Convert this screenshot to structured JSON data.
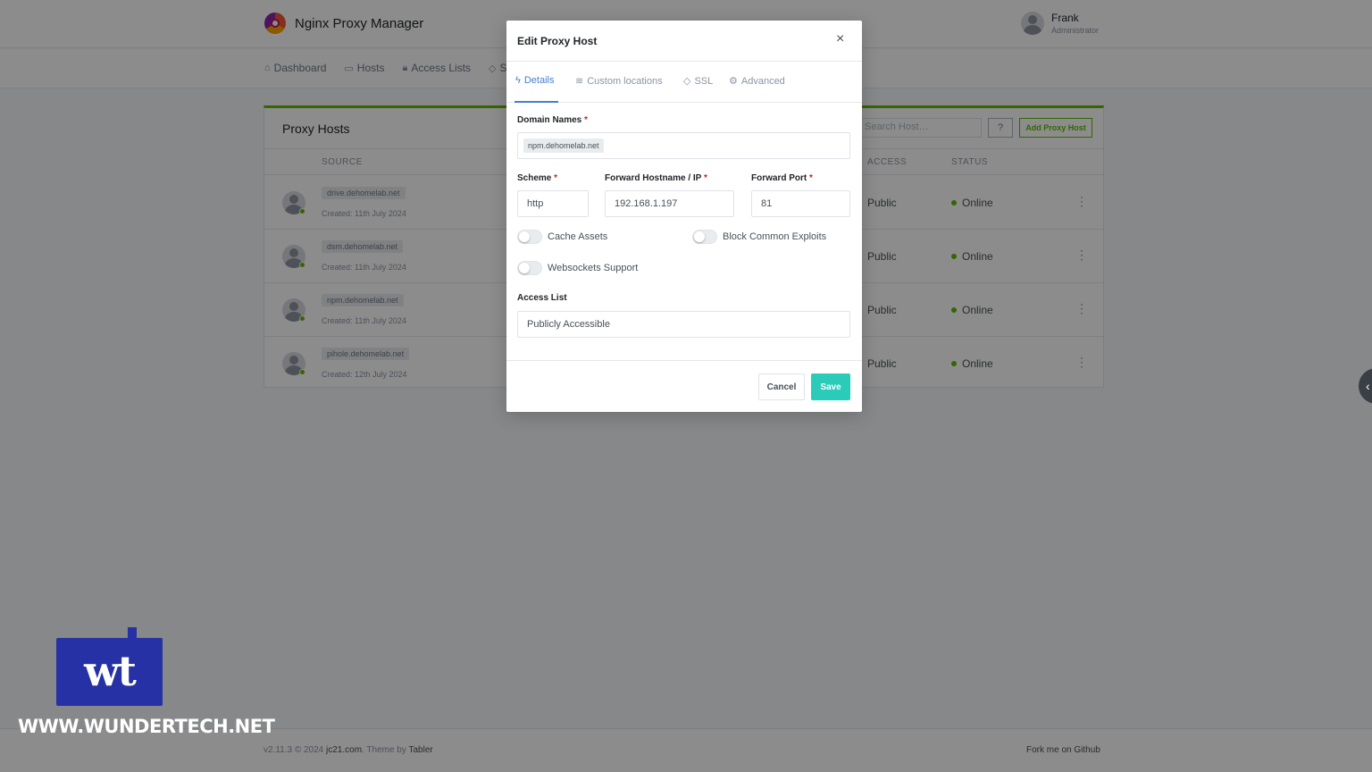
{
  "app": {
    "title": "Nginx Proxy Manager"
  },
  "user": {
    "name": "Frank",
    "role": "Administrator"
  },
  "nav": {
    "items": [
      {
        "label": "Dashboard",
        "icon": "home-icon"
      },
      {
        "label": "Hosts",
        "icon": "monitor-icon"
      },
      {
        "label": "Access Lists",
        "icon": "lock-icon"
      },
      {
        "label": "SSL",
        "icon": "shield-icon"
      }
    ]
  },
  "card": {
    "title": "Proxy Hosts",
    "search_placeholder": "Search Host…",
    "add_label": "Add Proxy Host",
    "columns": {
      "source": "SOURCE",
      "access": "ACCESS",
      "status": "STATUS"
    },
    "rows": [
      {
        "domain": "drive.dehomelab.net",
        "created": "Created: 11th July 2024",
        "access": "Public",
        "status": "Online"
      },
      {
        "domain": "dsm.dehomelab.net",
        "created": "Created: 11th July 2024",
        "access": "Public",
        "status": "Online"
      },
      {
        "domain": "npm.dehomelab.net",
        "created": "Created: 11th July 2024",
        "access": "Public",
        "status": "Online"
      },
      {
        "domain": "pihole.dehomelab.net",
        "created": "Created: 12th July 2024",
        "access": "Public",
        "status": "Online"
      }
    ]
  },
  "modal": {
    "title": "Edit Proxy Host",
    "tabs": [
      {
        "label": "Details",
        "icon": "bolt-icon",
        "active": true
      },
      {
        "label": "Custom locations",
        "icon": "layers-icon"
      },
      {
        "label": "SSL",
        "icon": "shield-icon"
      },
      {
        "label": "Advanced",
        "icon": "gear-icon"
      }
    ],
    "domain_names": {
      "label": "Domain Names",
      "required": "*",
      "value": "npm.dehomelab.net"
    },
    "scheme": {
      "label": "Scheme",
      "required": "*",
      "value": "http"
    },
    "forward_host": {
      "label": "Forward Hostname / IP",
      "required": "*",
      "value": "192.168.1.197"
    },
    "forward_port": {
      "label": "Forward Port",
      "required": "*",
      "value": "81"
    },
    "toggles": {
      "cache_assets": {
        "label": "Cache Assets",
        "on": false
      },
      "block_exploits": {
        "label": "Block Common Exploits",
        "on": false
      },
      "websockets": {
        "label": "Websockets Support",
        "on": false
      }
    },
    "access_list": {
      "label": "Access List",
      "value": "Publicly Accessible"
    },
    "cancel_label": "Cancel",
    "save_label": "Save"
  },
  "footer": {
    "version": "v2.11.3 © 2024",
    "author": "jc21.com",
    "theme_prefix": ". Theme by",
    "theme": "Tabler",
    "fork": "Fork me on Github"
  },
  "watermark": {
    "logo_text": "wt",
    "url": "WWW.WUNDERTECH.NET"
  },
  "colors": {
    "accent_green": "#5eba00",
    "accent_blue": "#467fcf",
    "save_teal": "#2bcbba",
    "watermark_blue": "#2631a6"
  }
}
